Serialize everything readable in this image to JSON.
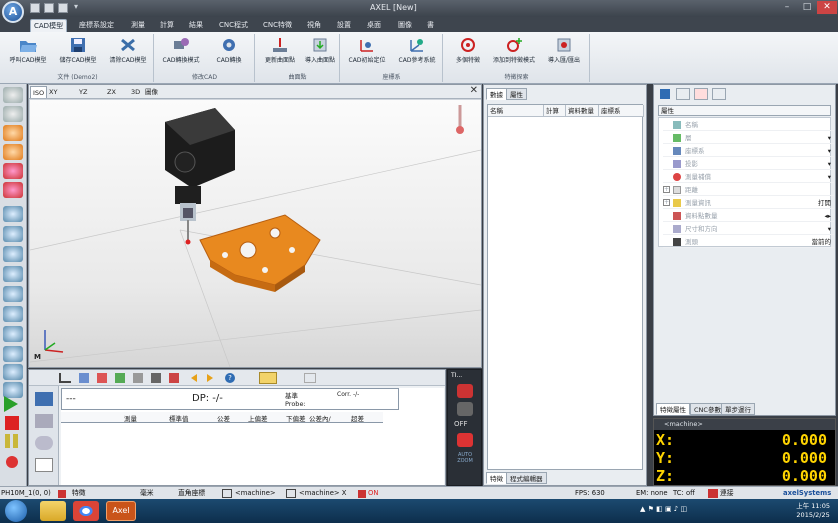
{
  "window": {
    "title": "AXEL [New]"
  },
  "menu_tabs": [
    "CAD模型",
    "座標系設定",
    "測量",
    "計算",
    "結果",
    "CNC程式",
    "CNC特徵",
    "視角",
    "設置",
    "桌面",
    "圖像",
    "書"
  ],
  "ribbon": {
    "groups": [
      {
        "label": "文件 (Demo2)",
        "buttons": [
          "呼叫CAD模型",
          "儲存CAD模型",
          "清除CAD模型"
        ]
      },
      {
        "label": "修改CAD",
        "buttons": [
          "CAD轉換模式",
          "CAD轉換"
        ]
      },
      {
        "label": "曲面點",
        "buttons": [
          "更新曲面點",
          "導入曲面點"
        ]
      },
      {
        "label": "座標系",
        "buttons": [
          "CAD初始定位",
          "CAD參考系統"
        ]
      },
      {
        "label": "特徵探索",
        "buttons": [
          "多個特徵",
          "添加到特徵模式",
          "導入匯/匯出"
        ]
      }
    ]
  },
  "viewport": {
    "tabs": [
      "ISO",
      "XY",
      "YZ",
      "ZX",
      "3D",
      "圖像"
    ],
    "active_tab": "ISO",
    "axis_label": "M",
    "close_glyph": "✕"
  },
  "measure_panel": {
    "title": "---",
    "dp_label": "DP: -/-",
    "base_label": "基準",
    "probe_label": "Probe:",
    "corr_label": "Corr. -/-",
    "columns": [
      "測量",
      "標準值",
      "公差",
      "上偏差",
      "下偏差",
      "公差內/",
      "超差"
    ]
  },
  "off_panel": {
    "title": "TI...",
    "off_text": "OFF",
    "auto_text": "AUTO ZOOM"
  },
  "mid_panel": {
    "tabs": [
      "數據",
      "屬性"
    ],
    "columns": [
      "名稱",
      "計算",
      "資料數量",
      "座標系"
    ],
    "bottom_tabs": [
      "特徵",
      "程式編輯器"
    ]
  },
  "prop_panel": {
    "header": "屬性",
    "rows": [
      {
        "label": "名稱",
        "value": ""
      },
      {
        "label": "層",
        "value": ""
      },
      {
        "label": "座標系",
        "value": ""
      },
      {
        "label": "投影",
        "value": ""
      },
      {
        "label": "測量補償",
        "value": ""
      },
      {
        "label": "距離",
        "value": ""
      },
      {
        "label": "測量資訊",
        "value": "打開"
      },
      {
        "label": "資料點數量",
        "value": ""
      },
      {
        "label": "尺寸和方向",
        "value": ""
      },
      {
        "label": "測頭",
        "value": "當前的"
      }
    ],
    "bottom_tabs": [
      "特徵屬性",
      "CNC參數",
      "單步運行"
    ]
  },
  "dro": {
    "title": "<machine>",
    "axes": [
      {
        "axis": "X:",
        "value": "0.000"
      },
      {
        "axis": "Y:",
        "value": "0.000"
      },
      {
        "axis": "Z:",
        "value": "0.000"
      }
    ]
  },
  "statusbar": {
    "probe": "PH10M_1(0, 0)",
    "feature": "特徵",
    "unit": "毫米",
    "coord": "直角座標",
    "machine1": "<machine>",
    "machine2": "<machine> X",
    "on": "ON",
    "fps": "FPS: 630",
    "em": "EM: none",
    "tc": "TC: off",
    "connect": "連接",
    "brand": "axelSystems"
  },
  "taskbar": {
    "time": "上午 11:05",
    "date": "2015/2/25",
    "app": "Axel"
  },
  "colors": {
    "accent": "#2f6cb3",
    "dro_text": "#ffd400",
    "part": "#e8891f"
  }
}
